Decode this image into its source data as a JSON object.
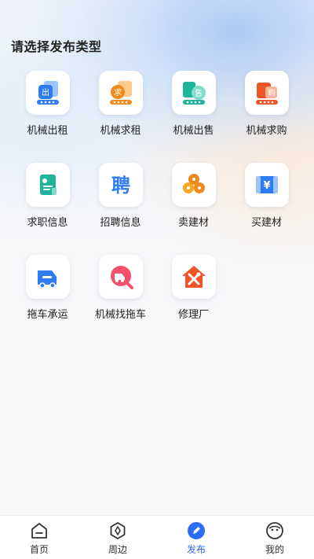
{
  "page_title": "请选择发布类型",
  "items": [
    {
      "label": "机械出租",
      "icon": "machinery-rent-out-icon",
      "glyph": "出"
    },
    {
      "label": "机械求租",
      "icon": "machinery-rent-wanted-icon",
      "glyph": "求"
    },
    {
      "label": "机械出售",
      "icon": "machinery-sale-icon",
      "glyph": "售"
    },
    {
      "label": "机械求购",
      "icon": "machinery-purchase-icon",
      "glyph": "购"
    },
    {
      "label": "求职信息",
      "icon": "job-seeking-icon"
    },
    {
      "label": "招聘信息",
      "icon": "recruitment-icon",
      "glyph": "聘"
    },
    {
      "label": "卖建材",
      "icon": "sell-materials-icon"
    },
    {
      "label": "买建材",
      "icon": "buy-materials-icon",
      "glyph": "¥"
    },
    {
      "label": "拖车承运",
      "icon": "tow-truck-icon"
    },
    {
      "label": "机械找拖车",
      "icon": "find-tow-truck-icon"
    },
    {
      "label": "修理厂",
      "icon": "repair-shop-icon"
    }
  ],
  "tabbar": {
    "tabs": [
      {
        "label": "首页",
        "icon": "home-icon"
      },
      {
        "label": "周边",
        "icon": "nearby-icon"
      },
      {
        "label": "发布",
        "icon": "publish-icon"
      },
      {
        "label": "我的",
        "icon": "profile-icon"
      }
    ],
    "active_index": 2,
    "active_color": "#2d6df6"
  },
  "colors": {
    "blue": "#2f7bf0",
    "orange": "#f08a1c",
    "teal": "#1fb59a",
    "red": "#f0552a"
  }
}
